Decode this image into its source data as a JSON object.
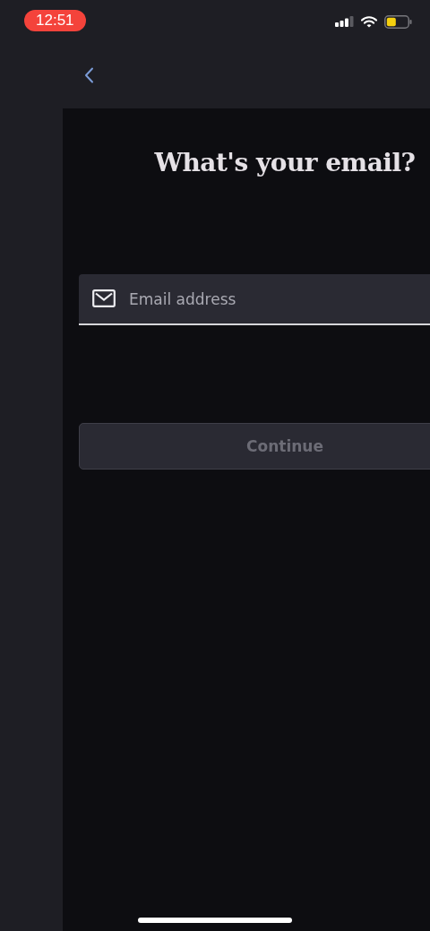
{
  "status_bar": {
    "time": "12:51"
  },
  "title": "What's your email?",
  "email_field": {
    "placeholder": "Email address"
  },
  "continue_button": {
    "label": "Continue",
    "disabled": true
  }
}
